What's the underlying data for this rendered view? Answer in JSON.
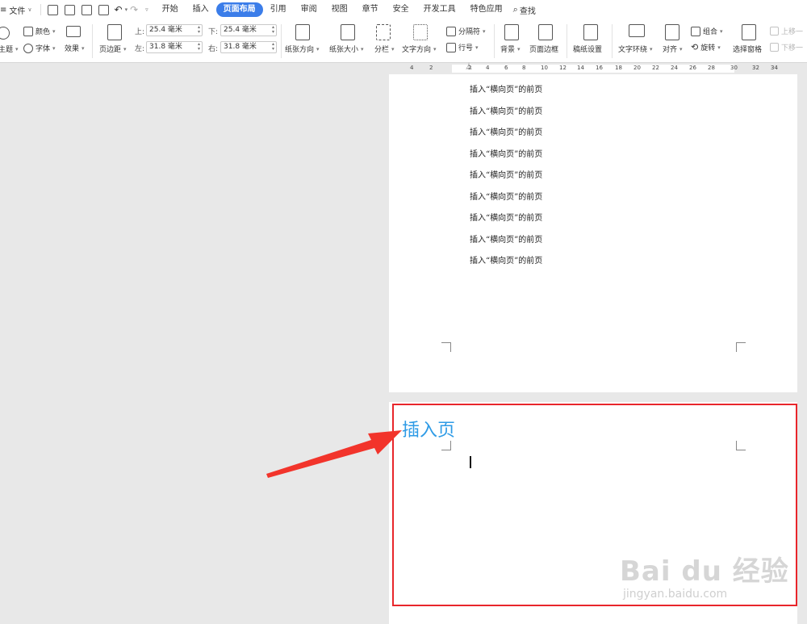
{
  "menubar": {
    "menu_icon": "≡",
    "file_label": "文件",
    "tabs": [
      {
        "label": "开始"
      },
      {
        "label": "插入"
      },
      {
        "label": "页面布局",
        "active": true
      },
      {
        "label": "引用"
      },
      {
        "label": "审阅"
      },
      {
        "label": "视图"
      },
      {
        "label": "章节"
      },
      {
        "label": "安全"
      },
      {
        "label": "开发工具"
      },
      {
        "label": "特色应用"
      }
    ],
    "search_label": "查找",
    "active_tab_color": "#3b7de9"
  },
  "ribbon": {
    "theme_label": "主题",
    "color_label": "颜色",
    "font_label": "字体",
    "effect_label": "效果",
    "margins_label": "页边距",
    "margins": {
      "top_label": "上:",
      "top_value": "25.4 毫米",
      "bottom_label": "下:",
      "bottom_value": "25.4 毫米",
      "left_label": "左:",
      "left_value": "31.8 毫米",
      "right_label": "右:",
      "right_value": "31.8 毫米"
    },
    "orientation_label": "纸张方向",
    "size_label": "纸张大小",
    "columns_label": "分栏",
    "text_direction_label": "文字方向",
    "breaks_label": "分隔符",
    "line_numbers_label": "行号",
    "background_label": "背景",
    "page_border_label": "页面边框",
    "manuscript_label": "稿纸设置",
    "wrap_text_label": "文字环绕",
    "align_label": "对齐",
    "group_label": "组合",
    "rotate_label": "旋转",
    "selection_pane_label": "选择窗格",
    "bring_forward_label": "上移一",
    "send_backward_label": "下移一"
  },
  "ruler": {
    "ticks": [
      "4",
      "2",
      "2",
      "4",
      "6",
      "8",
      "10",
      "12",
      "14",
      "16",
      "18",
      "20",
      "22",
      "24",
      "26",
      "28",
      "30",
      "32",
      "34"
    ]
  },
  "document": {
    "page1_lines": [
      "插入“横向页”的前页",
      "插入“横向页”的前页",
      "插入“横向页”的前页",
      "插入“横向页”的前页",
      "插入“横向页”的前页",
      "插入“横向页”的前页",
      "插入“横向页”的前页",
      "插入“横向页”的前页",
      "插入“横向页”的前页"
    ]
  },
  "annotation": {
    "title": "插入页",
    "title_color": "#2e9be6",
    "box_color": "#e8262b",
    "arrow_color": "#f2342b"
  },
  "watermark": {
    "main": "Bai du 经验",
    "sub": "jingyan.baidu.com"
  }
}
